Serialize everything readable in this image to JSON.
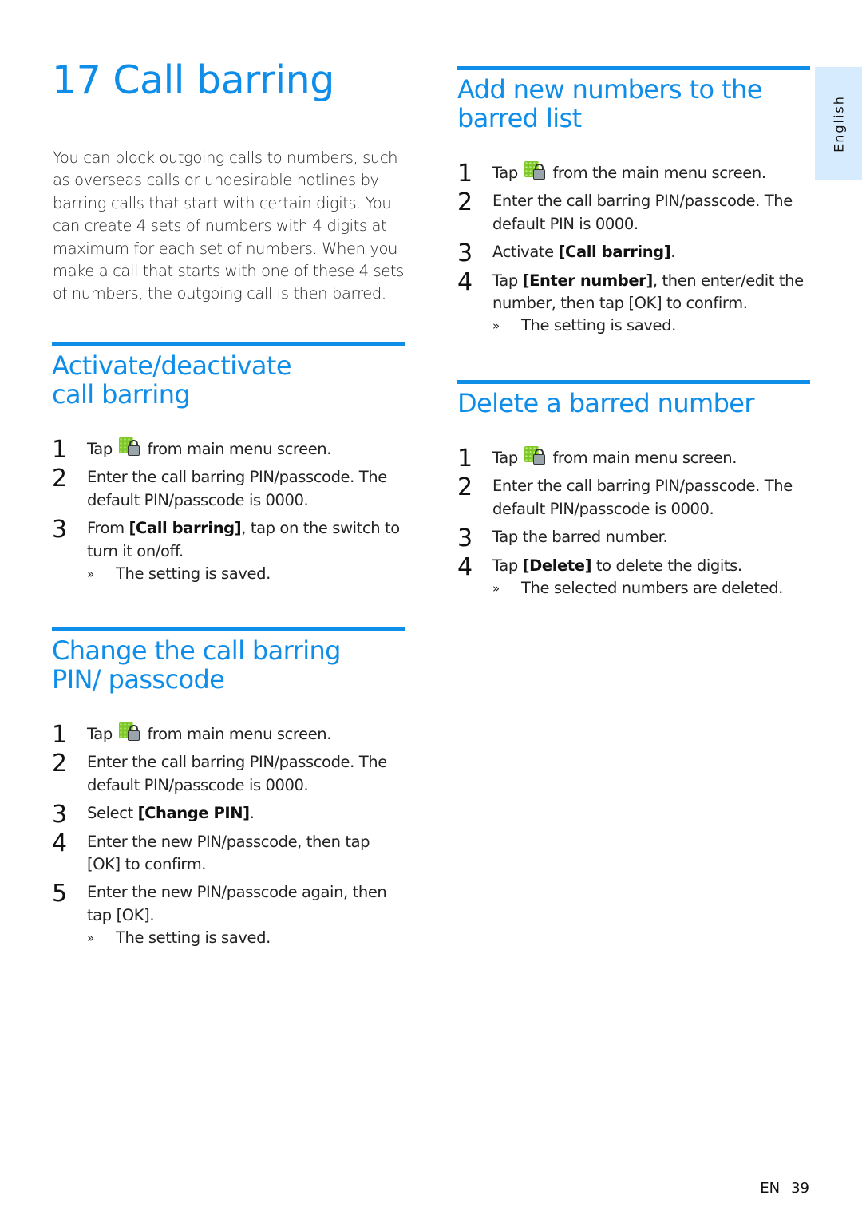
{
  "chapter": {
    "title": "17 Call barring",
    "intro": "You can block outgoing calls to numbers, such as overseas calls or undesirable hotlines by barring calls that start with certain digits. You can create 4 sets of numbers with 4 digits at maximum for each set of numbers. When you make a call that starts with one of these 4 sets of numbers, the outgoing call is then barred."
  },
  "icons": {
    "call_barring_app": "call-barring-app-icon",
    "result_marker": "»"
  },
  "colors": {
    "accent": "#0f8ee9",
    "language_tab": "#d6ebfd"
  },
  "sections": {
    "activate": {
      "title": "Activate/deactivate call barring",
      "steps": [
        {
          "num": "1",
          "pre": "Tap",
          "post": "from main menu screen."
        },
        {
          "num": "2",
          "text": "Enter the call barring PIN/passcode. The default PIN/passcode is 0000."
        },
        {
          "num": "3",
          "pre": "From ",
          "bold": "[Call barring]",
          "post": ", tap on the switch to turn it on/off."
        }
      ],
      "result": "The setting is saved."
    },
    "change_pin": {
      "title": "Change the call barring PIN/ passcode",
      "steps": [
        {
          "num": "1",
          "pre": "Tap",
          "post": "from main menu screen."
        },
        {
          "num": "2",
          "text": "Enter the call barring PIN/passcode. The default PIN/passcode is 0000."
        },
        {
          "num": "3",
          "pre": "Select ",
          "bold": "[Change PIN]",
          "post": "."
        },
        {
          "num": "4",
          "pre": "Enter the new PIN/passcode, then tap ",
          "bold": "[OK]",
          "post": " to confirm."
        },
        {
          "num": "5",
          "pre": "Enter the new PIN/passcode again, then tap ",
          "bold": "[OK]",
          "post": "."
        }
      ],
      "result": "The setting is saved."
    },
    "add_numbers": {
      "title": "Add new numbers to the barred list",
      "steps": [
        {
          "num": "1",
          "pre": "Tap",
          "post": "from the main menu screen."
        },
        {
          "num": "2",
          "text": "Enter the call barring PIN/passcode. The default PIN is 0000."
        },
        {
          "num": "3",
          "pre": "Activate ",
          "bold": "[Call barring]",
          "post": "."
        },
        {
          "num": "4",
          "pre": "Tap ",
          "bold": "[Enter number]",
          "post": ", then enter/edit the number, then tap [OK] to confirm."
        }
      ],
      "result": "The setting is saved."
    },
    "delete_number": {
      "title": "Delete a barred number",
      "steps": [
        {
          "num": "1",
          "pre": "Tap",
          "post": "from main menu screen."
        },
        {
          "num": "2",
          "text": "Enter the call barring PIN/passcode. The default PIN/passcode is 0000."
        },
        {
          "num": "3",
          "text": "Tap the barred number."
        },
        {
          "num": "4",
          "pre": "Tap ",
          "bold": "[Delete]",
          "post": " to delete the digits."
        }
      ],
      "result": "The selected numbers are deleted."
    }
  },
  "language_tab": "English",
  "footer": {
    "lang": "EN",
    "page": "39"
  }
}
